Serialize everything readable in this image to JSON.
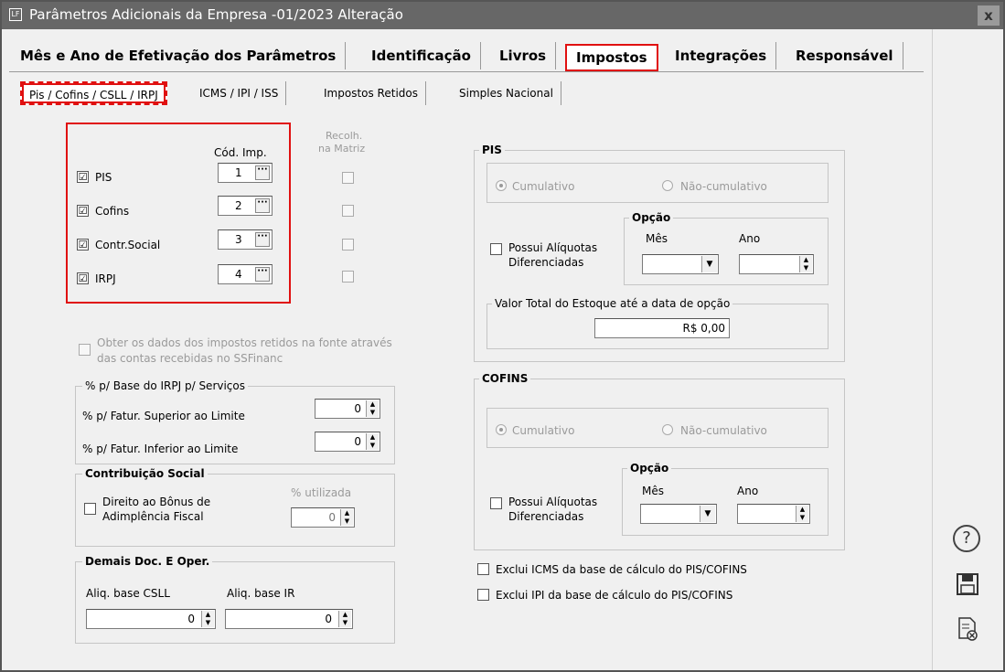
{
  "window": {
    "title": "Parâmetros Adicionais da Empresa -01/2023 Alteração",
    "app_icon": "LF",
    "close": "x"
  },
  "tabs": [
    "Mês e Ano de Efetivação dos Parâmetros",
    "Identificação",
    "Livros",
    "Impostos",
    "Integrações",
    "Responsável"
  ],
  "subtabs": [
    "Pis / Cofins / CSLL / IRPJ",
    "ICMS / IPI / ISS",
    "Impostos Retidos",
    "Simples Nacional"
  ],
  "taxes": {
    "col_cod": "Cód. Imp.",
    "col_recolh": "Recolh.",
    "col_matriz": "na Matriz",
    "rows": [
      {
        "label": "PIS",
        "checked": "☑",
        "code": "1"
      },
      {
        "label": "Cofins",
        "checked": "☑",
        "code": "2"
      },
      {
        "label": "Contr.Social",
        "checked": "☑",
        "code": "3"
      },
      {
        "label": "IRPJ",
        "checked": "☑",
        "code": "4"
      }
    ],
    "ellipsis": "···"
  },
  "obter": {
    "line1": "Obter os dados dos impostos retidos na fonte através",
    "line2": "das contas recebidas no SSFinanc"
  },
  "irpj_base": {
    "title": "% p/ Base do IRPJ p/ Serviços",
    "superior": "% p/ Fatur. Superior ao Limite",
    "superior_val": "0",
    "inferior": "% p/ Fatur. Inferior ao Limite",
    "inferior_val": "0"
  },
  "contrib": {
    "title": "Contribuição Social",
    "direito1": "Direito ao Bônus de",
    "direito2": "Adimplência Fiscal",
    "utilizada": "% utilizada",
    "utilizada_val": "0"
  },
  "demais": {
    "title": "Demais Doc. E Oper.",
    "csll": "Aliq. base CSLL",
    "csll_val": "0",
    "ir": "Aliq. base IR",
    "ir_val": "0"
  },
  "pis": {
    "title": "PIS",
    "cumulativo": "Cumulativo",
    "nao_cumulativo": "Não-cumulativo",
    "possui1": "Possui Alíquotas",
    "possui2": "Diferenciadas",
    "opcao": "Opção",
    "mes": "Mês",
    "ano": "Ano",
    "estoque": "Valor Total do Estoque até a data de opção",
    "estoque_val": "R$ 0,00"
  },
  "cofins": {
    "title": "COFINS",
    "cumulativo": "Cumulativo",
    "nao_cumulativo": "Não-cumulativo",
    "possui1": "Possui Alíquotas",
    "possui2": "Diferenciadas",
    "opcao": "Opção",
    "mes": "Mês",
    "ano": "Ano"
  },
  "exclui_icms": "Exclui ICMS da base de cálculo do PIS/COFINS",
  "exclui_ipi": "Exclui IPI da base de cálculo do PIS/COFINS",
  "side_icons": [
    "help-icon",
    "save-icon",
    "cancel-doc-icon"
  ],
  "glyphs": {
    "up": "▲",
    "down": "▼",
    "help": "?",
    "save": "💾",
    "cancel": "🗎"
  }
}
